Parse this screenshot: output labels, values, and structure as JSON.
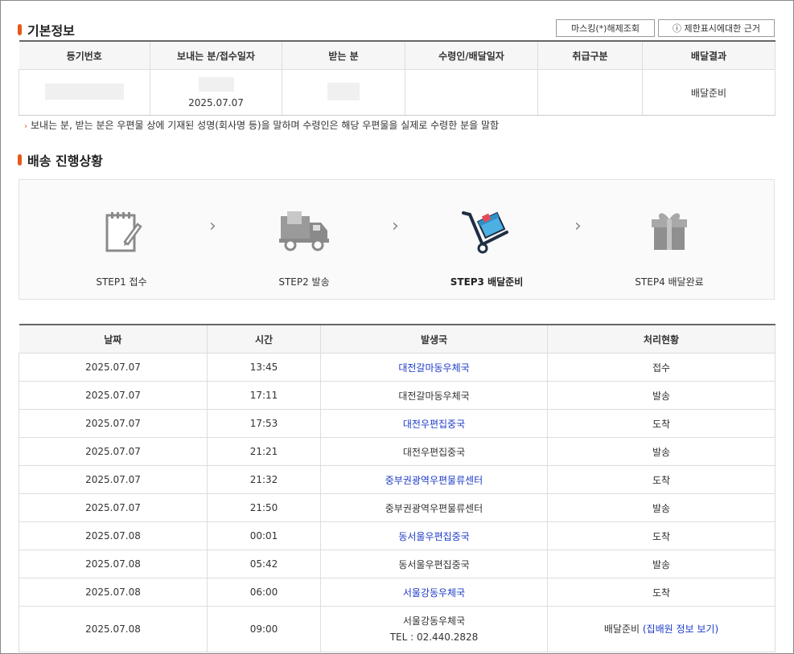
{
  "basic_info": {
    "title": "기본정보",
    "btn_masking": "마스킹(*)해제조회",
    "btn_restriction": "ⓘ 제한표시에대한 근거",
    "headers": [
      "등기번호",
      "보내는 분/접수일자",
      "받는 분",
      "수령인/배달일자",
      "취급구분",
      "배달결과"
    ],
    "row": {
      "date": "2025.07.07",
      "result": "배달준비"
    },
    "note": "보내는 분, 받는 분은 우편물 상에 기재된 성명(회사명 등)을 말하며 수령인은 해당 우편물을 실제로 수령한 분을 말함"
  },
  "progress": {
    "title": "배송 진행상황",
    "steps": [
      {
        "label": "STEP1 접수",
        "icon": "notepad-icon"
      },
      {
        "label": "STEP2 발송",
        "icon": "truck-icon"
      },
      {
        "label": "STEP3 배달준비",
        "icon": "hand-cart-icon"
      },
      {
        "label": "STEP4 배달완료",
        "icon": "gift-box-icon"
      }
    ],
    "active_step": 3
  },
  "history": {
    "headers": [
      "날짜",
      "시간",
      "발생국",
      "처리현황"
    ],
    "rows": [
      {
        "date": "2025.07.07",
        "time": "13:45",
        "office": "대전갈마동우체국",
        "link": true,
        "status": "접수"
      },
      {
        "date": "2025.07.07",
        "time": "17:11",
        "office": "대전갈마동우체국",
        "link": false,
        "status": "발송"
      },
      {
        "date": "2025.07.07",
        "time": "17:53",
        "office": "대전우편집중국",
        "link": true,
        "status": "도착"
      },
      {
        "date": "2025.07.07",
        "time": "21:21",
        "office": "대전우편집중국",
        "link": false,
        "status": "발송"
      },
      {
        "date": "2025.07.07",
        "time": "21:32",
        "office": "중부권광역우편물류센터",
        "link": true,
        "status": "도착"
      },
      {
        "date": "2025.07.07",
        "time": "21:50",
        "office": "중부권광역우편물류센터",
        "link": false,
        "status": "발송"
      },
      {
        "date": "2025.07.08",
        "time": "00:01",
        "office": "동서울우편집중국",
        "link": true,
        "status": "도착"
      },
      {
        "date": "2025.07.08",
        "time": "05:42",
        "office": "동서울우편집중국",
        "link": false,
        "status": "발송"
      },
      {
        "date": "2025.07.08",
        "time": "06:00",
        "office": "서울강동우체국",
        "link": true,
        "status": "도착"
      },
      {
        "date": "2025.07.08",
        "time": "09:00",
        "office": "서울강동우체국",
        "link": false,
        "tel": "TEL : 02.440.2828",
        "status": "배달준비",
        "status_link": "(집배원 정보 보기)"
      }
    ]
  },
  "colors": {
    "accent": "#e55a1b",
    "link": "#1d3bc8"
  }
}
